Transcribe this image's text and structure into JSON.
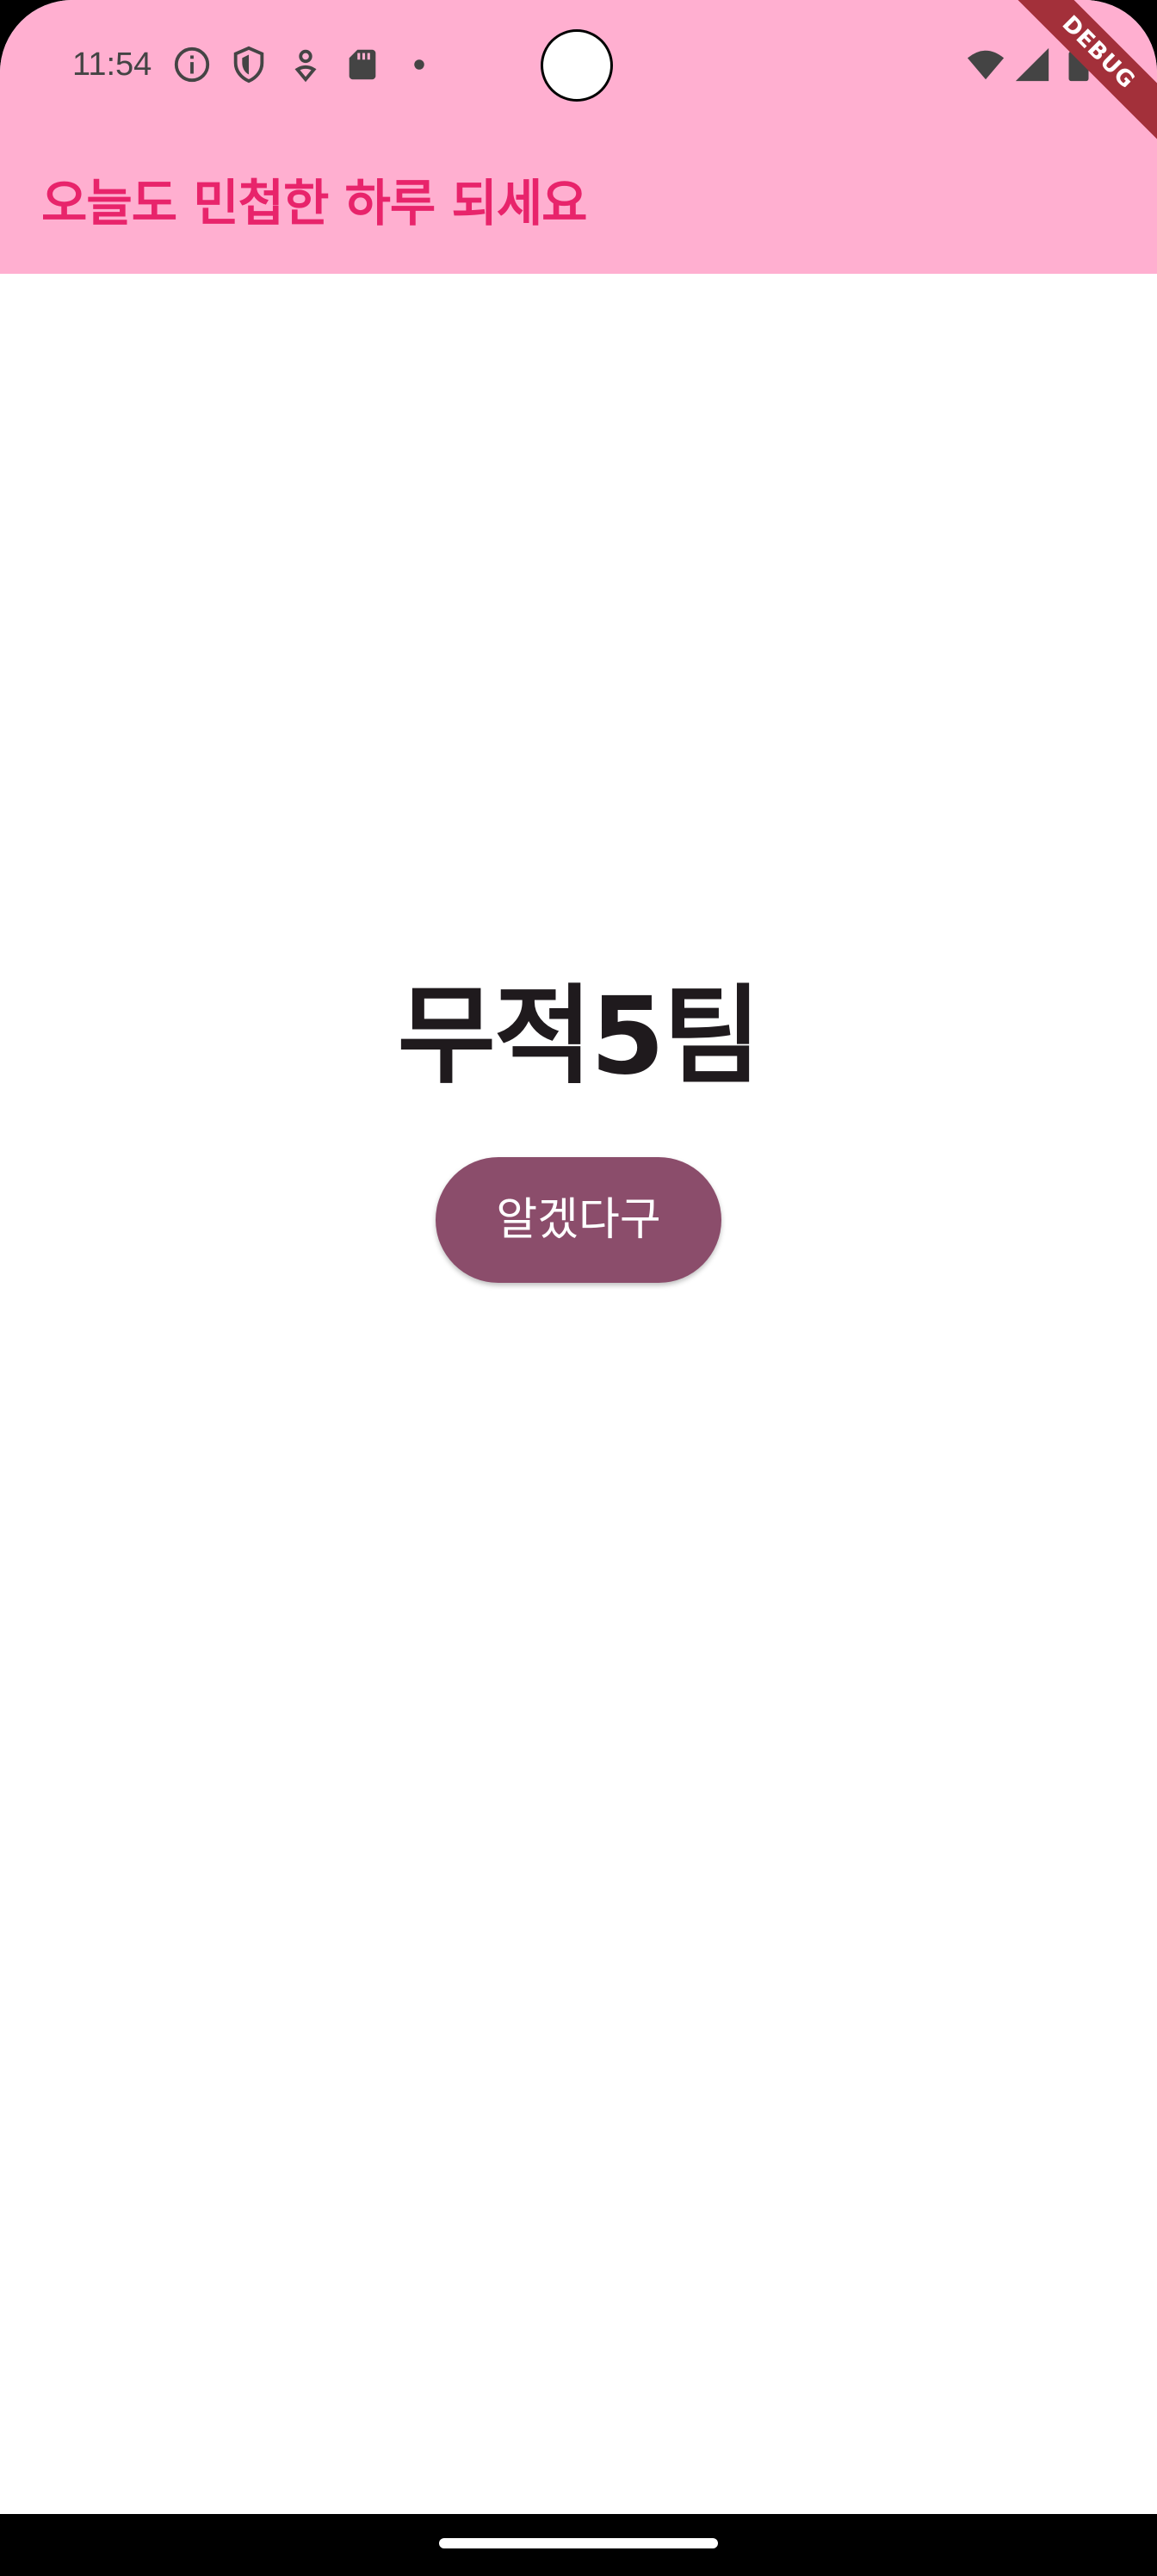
{
  "status_bar": {
    "time": "11:54",
    "left_icons": [
      "info-icon",
      "shield-icon",
      "location-pin-icon",
      "sd-card-icon",
      "dot-icon"
    ],
    "right_icons": [
      "wifi-icon",
      "cell-signal-icon",
      "battery-icon"
    ]
  },
  "debug_banner": "DEBUG",
  "app_bar": {
    "title": "오늘도 민첩한 하루 되세요",
    "background": "#ffafd0",
    "title_color": "#e8246b"
  },
  "main": {
    "heading": "무적5팀",
    "button_label": "알겠다구",
    "button_color": "#8b4d6b"
  }
}
